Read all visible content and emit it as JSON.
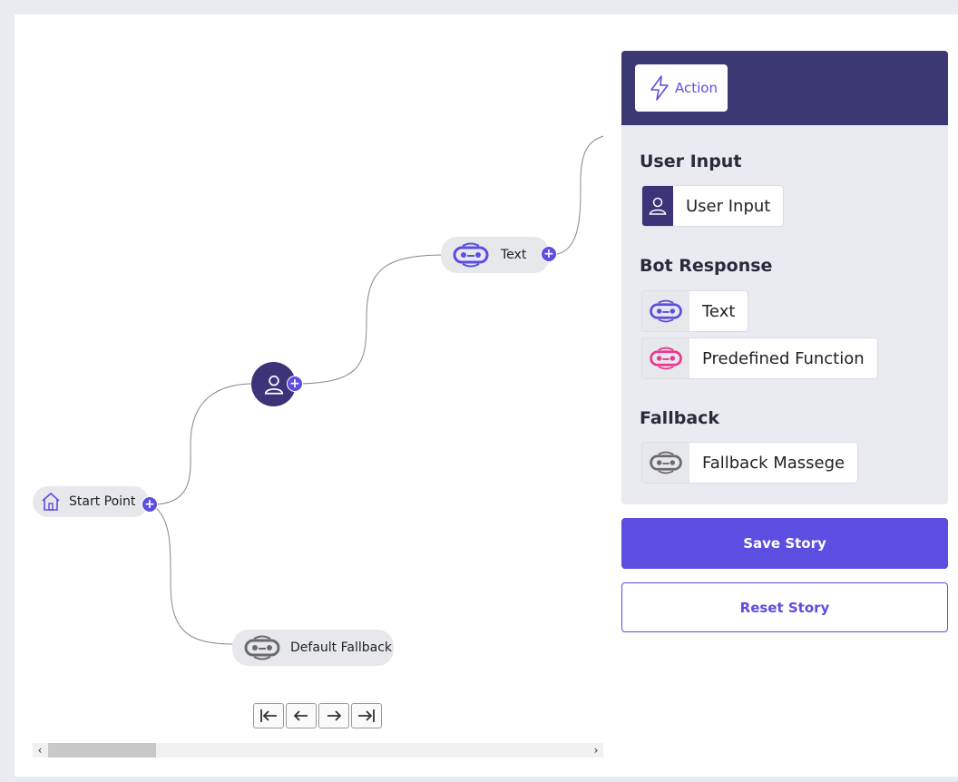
{
  "canvas": {
    "nodes": {
      "start": {
        "label": "Start Point",
        "icon": "house-icon"
      },
      "text": {
        "label": "Text",
        "icon": "bot-icon"
      },
      "user": {
        "icon": "user-icon"
      },
      "fallback": {
        "label": "Default Fallback",
        "icon": "bot-icon"
      }
    },
    "plus_glyph": "+",
    "pager": [
      "first-page-icon",
      "prev-page-icon",
      "next-page-icon",
      "last-page-icon"
    ],
    "scroll_left": "‹",
    "scroll_right": "›"
  },
  "panel": {
    "action_label": "Action",
    "sections": {
      "user_input": {
        "title": "User Input",
        "items": [
          {
            "label": "User Input",
            "icon": "user-icon"
          }
        ]
      },
      "bot_response": {
        "title": "Bot Response",
        "items": [
          {
            "label": "Text",
            "icon": "bot-icon"
          },
          {
            "label": "Predefined Function",
            "icon": "bot-icon"
          }
        ]
      },
      "fallback": {
        "title": "Fallback",
        "items": [
          {
            "label": "Fallback Massege",
            "icon": "bot-icon"
          }
        ]
      }
    }
  },
  "buttons": {
    "save": "Save Story",
    "reset": "Reset Story"
  },
  "colors": {
    "primary": "#5b4ee0",
    "header": "#3b3873",
    "user_node": "#3c3378",
    "predefined": "#e8388f",
    "fallback_icon": "#6b6b6b"
  }
}
